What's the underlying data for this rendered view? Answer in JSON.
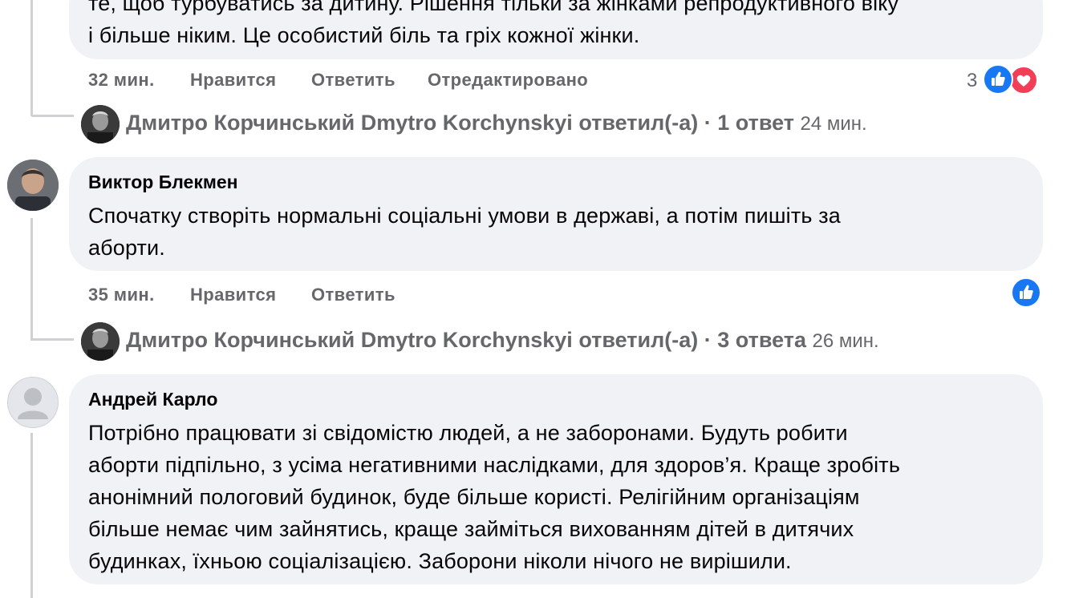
{
  "comments": [
    {
      "text_lines": [
        "те, щоб турбуватись за дитину. Рішення тільки за жінками репродуктивного віку",
        "і більше ніким. Це особистий біль та гріх кожної жінки."
      ],
      "time": "32 мин.",
      "like_label": "Нравится",
      "reply_label": "Ответить",
      "edited_label": "Отредактировано",
      "reaction_count": "3",
      "reactions": [
        "like-icon",
        "love-icon"
      ]
    },
    {
      "author": "Виктор Блекмен",
      "text_lines": [
        "Спочатку створіть нормальні соціальні умови в державі, а потім пишіть за",
        "аборти."
      ],
      "time": "35 мин.",
      "like_label": "Нравится",
      "reply_label": "Ответить",
      "reactions": [
        "like-icon"
      ]
    },
    {
      "author": "Андрей Карло",
      "text_lines": [
        "Потрібно працювати зі свідомістю людей, а не заборонами. Будуть робити",
        "аборти підпільно, з усіма негативними наслідками, для здоров’я. Краще зробіть",
        "анонімний пологовий будинок, буде більше користі.  Релігійним організаціям",
        "більше немає чим зайнятись, краще займіться вихованням дітей в дитячих",
        "будинках, їхньою соціалізацією. Заборони ніколи нічого не вирішили."
      ]
    }
  ],
  "replies": [
    {
      "author": "Дмитро Корчинський Dmytro Korchynskyi",
      "action": "ответил(-а)",
      "separator": "·",
      "count": "1 ответ",
      "time": "24 мин."
    },
    {
      "author": "Дмитро Корчинський Dmytro Korchynskyi",
      "action": "ответил(-а)",
      "separator": "·",
      "count": "3 ответа",
      "time": "26 мин."
    }
  ],
  "colors": {
    "bubble": "#f0f2f5",
    "meta": "#65676b",
    "like_blue": "#1877f2",
    "love_red": "#f33e58",
    "thread_line": "#ced0d4"
  }
}
